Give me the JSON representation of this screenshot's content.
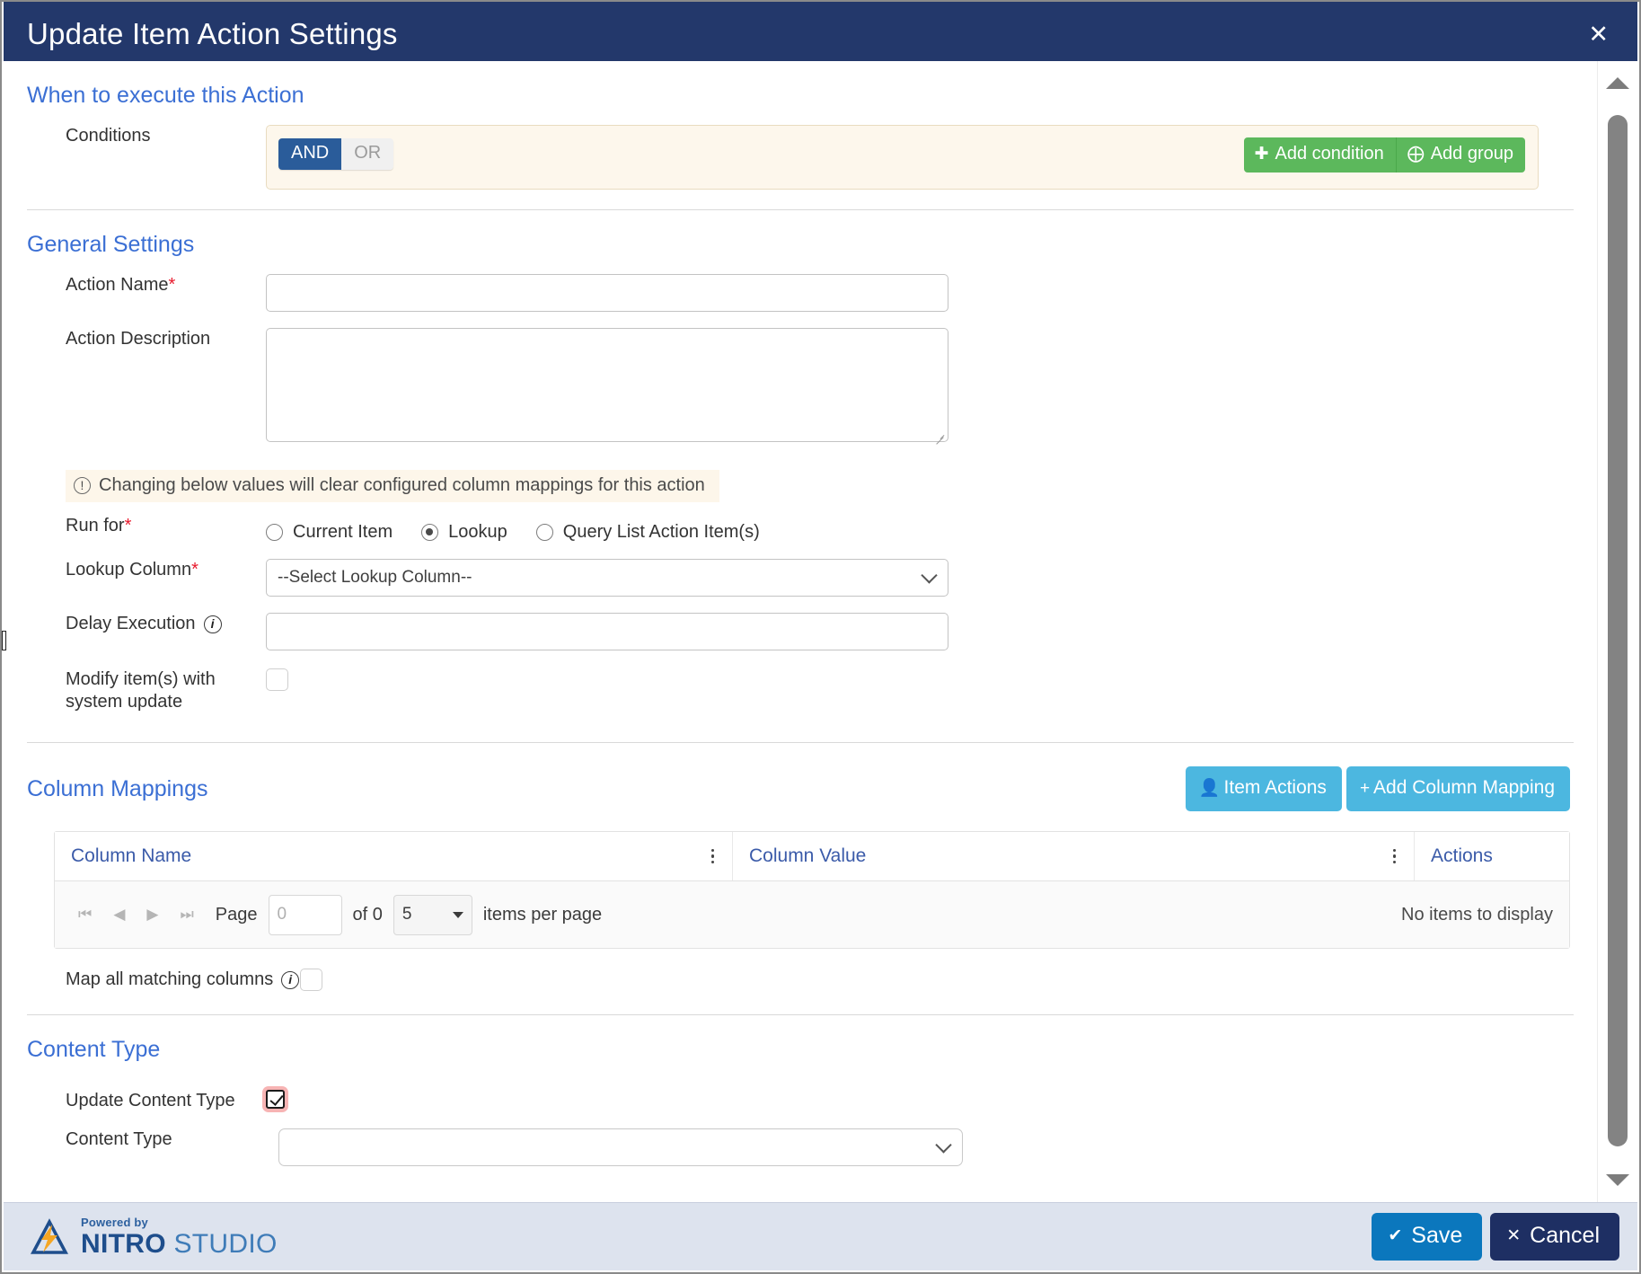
{
  "window": {
    "title": "Update Item Action Settings",
    "close_label": "✕"
  },
  "sections": {
    "when_to_execute": "When to execute this Action",
    "general_settings": "General Settings",
    "column_mappings": "Column Mappings",
    "content_type": "Content Type"
  },
  "conditions": {
    "label": "Conditions",
    "operator_and": "AND",
    "operator_or": "OR",
    "selected_operator": "AND",
    "add_condition": "Add condition",
    "add_group": "Add group"
  },
  "general": {
    "action_name_label": "Action Name",
    "action_name_value": "",
    "action_description_label": "Action Description",
    "action_description_value": "",
    "warning_text": "Changing below values will clear configured column mappings for this action",
    "run_for_label": "Run for",
    "run_for_options": [
      {
        "label": "Current Item",
        "selected": false
      },
      {
        "label": "Lookup",
        "selected": true
      },
      {
        "label": "Query List Action Item(s)",
        "selected": false
      }
    ],
    "lookup_column_label": "Lookup Column",
    "lookup_column_value": "--Select Lookup Column--",
    "delay_execution_label": "Delay Execution",
    "delay_execution_value": "",
    "modify_items_label": "Modify item(s) with system update",
    "modify_items_checked": false
  },
  "column_mappings": {
    "item_actions_button": "Item Actions",
    "add_column_mapping_button": "Add Column Mapping",
    "columns": [
      "Column Name",
      "Column Value",
      "Actions"
    ],
    "rows": [],
    "pager": {
      "page_label": "Page",
      "page_value": "0",
      "of_label": "of 0",
      "items_per_page_value": "5",
      "items_per_page_label": "items per page",
      "empty_text": "No items to display",
      "first_icon": "⏮",
      "prev_icon": "◀",
      "next_icon": "▶",
      "last_icon": "⏭"
    },
    "map_all_label": "Map all matching columns",
    "map_all_checked": false
  },
  "content_type": {
    "update_label": "Update Content Type",
    "update_checked": true,
    "content_type_label": "Content Type",
    "content_type_value": ""
  },
  "footer": {
    "powered_by": "Powered by",
    "brand_bold": "NITRO",
    "brand_light": " STUDIO",
    "save_label": "Save",
    "cancel_label": "Cancel",
    "save_icon": "✔",
    "cancel_icon": "✕"
  },
  "colors": {
    "titlebar": "#23386b",
    "accent_heading": "#3b6fd4",
    "green": "#5cb85c",
    "blue_button": "#4cb7e0",
    "save": "#0b77bd",
    "cancel": "#1e2f63",
    "required": "#e8192c"
  }
}
